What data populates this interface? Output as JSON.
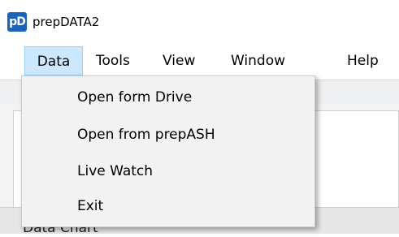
{
  "window": {
    "logo_text": "pD",
    "title": "prepDATA2"
  },
  "menubar": {
    "items": [
      "Data",
      "Tools",
      "View",
      "Window",
      "Help"
    ],
    "active": "Data"
  },
  "dropdown": {
    "items": [
      "Open form Drive",
      "Open from prepASH",
      "Live Watch",
      "Exit"
    ]
  },
  "background": {
    "partial_label": "Data Chart"
  },
  "colors": {
    "logo_bg": "#1565c0",
    "menu_highlight": "#cce8ff",
    "menu_highlight_border": "#99d1ff"
  }
}
